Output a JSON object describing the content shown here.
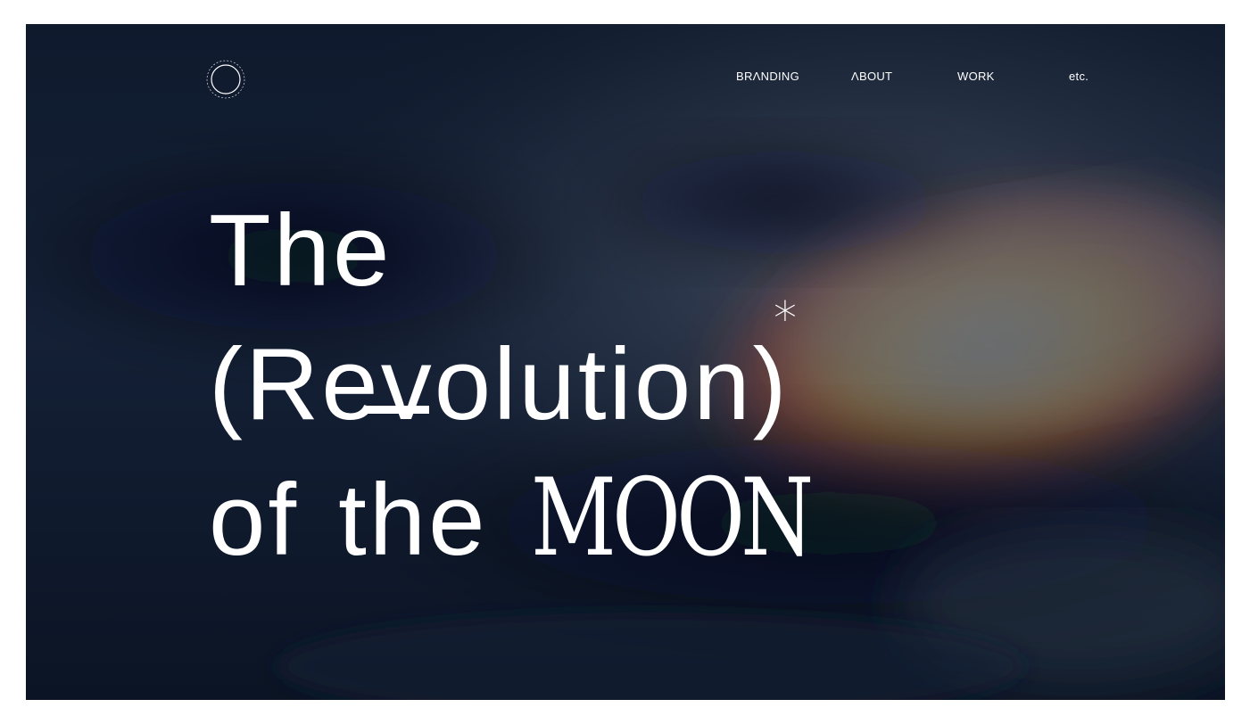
{
  "brand": {
    "logo_icon": "crescent-moon-circle-logo",
    "logo_text": "the revolution of the moon"
  },
  "nav": {
    "items": [
      {
        "label": "BRΛNDING",
        "icon": null
      },
      {
        "label": "ΛBOUT",
        "icon": null
      },
      {
        "label": "WORK",
        "icon": null
      },
      {
        "label": "etc.",
        "icon": null
      }
    ]
  },
  "hero": {
    "line1": "The",
    "line2": "(Revolution)",
    "asterisk": "*",
    "line3_part1": "of",
    "line3_part2": "the",
    "line3_highlight": "MOON"
  },
  "colors": {
    "text": "#ffffff",
    "background_dark": "#111b2e",
    "glow_warm": "#d9a326",
    "glow_edge": "#c0472a"
  }
}
